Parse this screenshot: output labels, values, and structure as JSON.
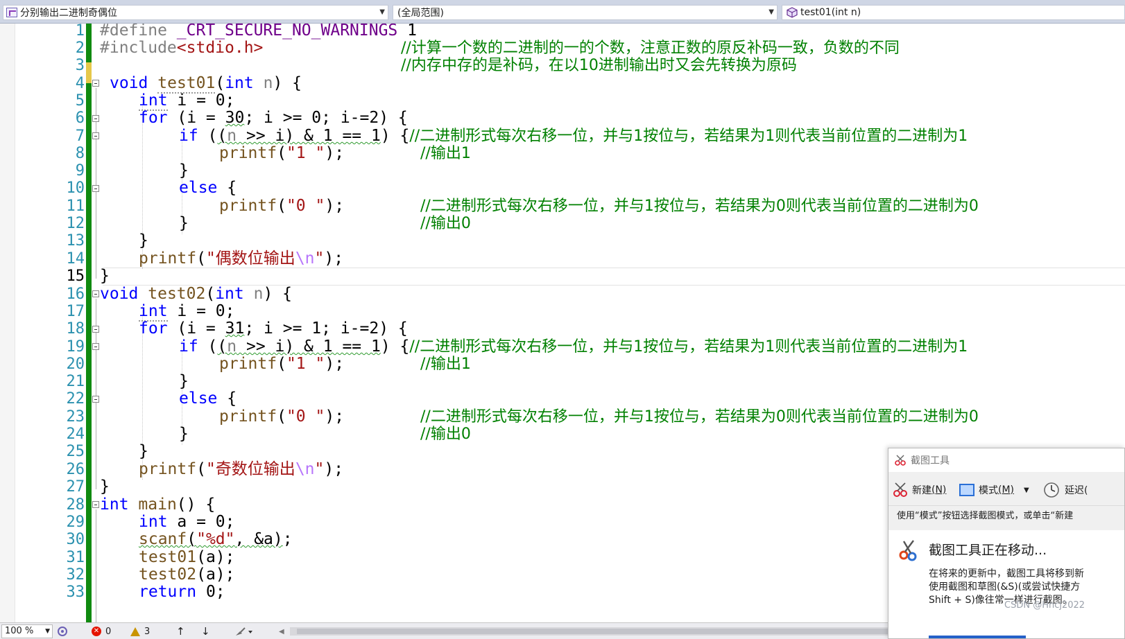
{
  "navbar": {
    "project_combo": "分别输出二进制奇偶位",
    "scope_combo": "(全局范围)",
    "member_combo": "test01(int n)"
  },
  "editor": {
    "line_numbers": [
      "1",
      "2",
      "3",
      "4",
      "5",
      "6",
      "7",
      "8",
      "9",
      "10",
      "11",
      "12",
      "13",
      "14",
      "15",
      "16",
      "17",
      "18",
      "19",
      "20",
      "21",
      "22",
      "23",
      "24",
      "25",
      "26",
      "27",
      "28",
      "29",
      "30",
      "31",
      "32",
      "33"
    ],
    "current_line": "15",
    "comments": {
      "c2": "//计算一个数的二进制的一的个数，注意正数的原反补码一致，负数的不同",
      "c3": "//内存中存的是补码，在以10进制输出时又会先转换为原码",
      "c7": "//二进制形式每次右移一位，并与1按位与，若结果为1则代表当前位置的二进制为1",
      "c8": "//输出1",
      "c11": "//二进制形式每次右移一位，并与1按位与，若结果为0则代表当前位置的二进制为0",
      "c12": "//输出0",
      "c19": "//二进制形式每次右移一位，并与1按位与，若结果为1则代表当前位置的二进制为1",
      "c20": "//输出1",
      "c23": "//二进制形式每次右移一位，并与1按位与，若结果为0则代表当前位置的二进制为0",
      "c24": "//输出0"
    },
    "strings": {
      "s14": "\"偶数位输出",
      "s26": "\"奇数位输出"
    }
  },
  "statusbar": {
    "zoom": "100 %",
    "errors": "0",
    "warnings": "3"
  },
  "snipping_tool": {
    "title": "截图工具",
    "new_label": "新建",
    "new_key": "(N)",
    "mode_label": "模式",
    "mode_key": "(M)",
    "delay_label": "延迟(",
    "hint": "使用“模式”按钮选择截图模式，或单击“新建",
    "heading": "截图工具正在移动...",
    "text1": "在将来的更新中，截图工具将移到新",
    "text2": "使用截图和草图(&S)(或尝试快捷方",
    "text3": "Shift + S)像往常一样进行截图。"
  },
  "watermark": "CSDN @Hncj2022",
  "colors": {
    "keyword": "#0000ff",
    "comment": "#008000",
    "string": "#a31515",
    "preprocessor": "#808080",
    "macro": "#6f008a",
    "line_number": "#2b91af",
    "change_bar": "#108a10"
  }
}
